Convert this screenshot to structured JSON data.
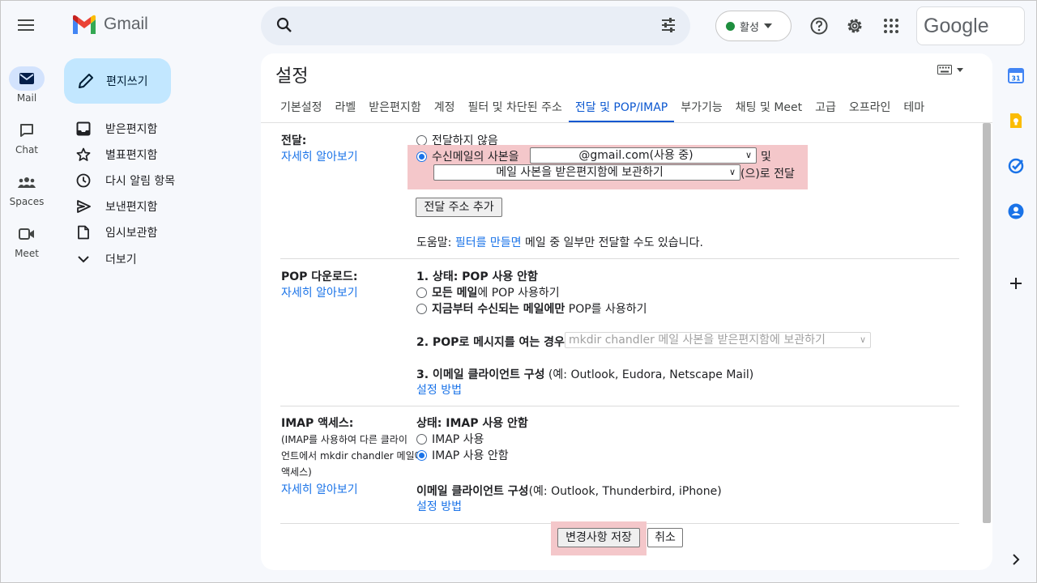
{
  "app": {
    "name": "Gmail"
  },
  "rail": [
    {
      "label": "Mail",
      "icon": "mail-icon"
    },
    {
      "label": "Chat",
      "icon": "chat-icon"
    },
    {
      "label": "Spaces",
      "icon": "spaces-icon"
    },
    {
      "label": "Meet",
      "icon": "meet-icon"
    }
  ],
  "header": {
    "status_label": "활성",
    "google_label": "Google"
  },
  "sidebar": {
    "compose_label": "편지쓰기",
    "items": [
      {
        "label": "받은편지함",
        "icon": "inbox-icon"
      },
      {
        "label": "별표편지함",
        "icon": "star-icon"
      },
      {
        "label": "다시 알림 항목",
        "icon": "clock-icon"
      },
      {
        "label": "보낸편지함",
        "icon": "send-icon"
      },
      {
        "label": "임시보관함",
        "icon": "draft-icon"
      },
      {
        "label": "더보기",
        "icon": "chevron-down-icon"
      }
    ]
  },
  "settings": {
    "title": "설정",
    "tabs": [
      "기본설정",
      "라벨",
      "받은편지함",
      "계정",
      "필터 및 차단된 주소",
      "전달 및 POP/IMAP",
      "부가기능",
      "채팅 및 Meet",
      "고급",
      "오프라인",
      "테마"
    ],
    "active_tab": "전달 및 POP/IMAP",
    "forwarding": {
      "title": "전달:",
      "learn_more": "자세히 알아보기",
      "opt_none": "전달하지 않음",
      "opt_copy_prefix": "수신메일의 사본을",
      "address_select": "@gmail.com(사용 중)",
      "and": "및",
      "action_select": "메일 사본을 받은편지함에 보관하기",
      "suffix": "(으)로 전달",
      "add_button": "전달 주소 추가",
      "tip_prefix": "도움말: ",
      "tip_link": "필터를 만들면",
      "tip_suffix": " 메일 중 일부만 전달할 수도 있습니다."
    },
    "pop": {
      "title": "POP 다운로드:",
      "learn_more": "자세히 알아보기",
      "status": "1. 상태: POP 사용 안함",
      "opt_all_bold": "모든 메일",
      "opt_all_rest": "에 POP 사용하기",
      "opt_new_bold": "지금부터 수신되는 메일에만",
      "opt_new_rest": " POP를 사용하기",
      "step2": "2. POP로 메시지를 여는 경우",
      "step2_select": "mkdir chandler 메일 사본을 받은편지함에 보관하기",
      "step3_bold": "3. 이메일 클라이언트 구성",
      "step3_rest": " (예: Outlook, Eudora, Netscape Mail)",
      "setup_link": "설정 방법"
    },
    "imap": {
      "title": "IMAP 액세스:",
      "desc1": "(IMAP를 사용하여 다른 클라이",
      "desc2": "언트에서 mkdir chandler 메일에",
      "desc3": "액세스)",
      "learn_more": "자세히 알아보기",
      "status": "상태: IMAP 사용 안함",
      "opt_enable": "IMAP 사용",
      "opt_disable": "IMAP 사용 안함",
      "client_bold": "이메일 클라이언트 구성",
      "client_rest": "(예: Outlook, Thunderbird, iPhone)",
      "setup_link": "설정 방법"
    },
    "save_button": "변경사항 저장",
    "cancel_button": "취소"
  },
  "colors": {
    "accent": "#0b57d0",
    "link": "#1a73e8",
    "highlight": "#f4c7ca",
    "compose": "#c2e7ff"
  }
}
